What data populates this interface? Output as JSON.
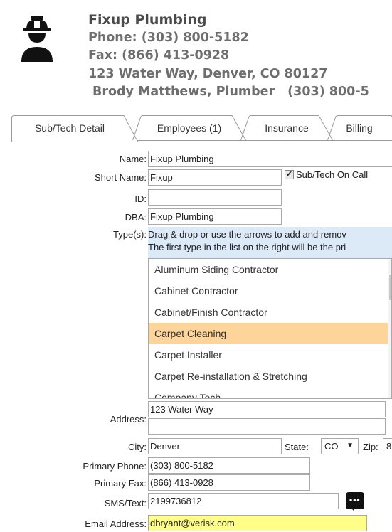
{
  "header": {
    "icon": "construction-worker-icon",
    "company_name": "Fixup Plumbing",
    "phone": "Phone: (303) 800-5182",
    "fax": "Fax: (866) 413-0928",
    "address": "123 Water Way, Denver, CO 80127",
    "contact_name": "Brody Matthews, Plumber",
    "contact_phone": "(303) 800-5"
  },
  "tabs": [
    {
      "label": "Sub/Tech Detail",
      "active": true
    },
    {
      "label": "Employees (1)",
      "active": false
    },
    {
      "label": "Insurance",
      "active": false
    },
    {
      "label": "Billing",
      "active": false
    }
  ],
  "form": {
    "name_label": "Name:",
    "name_value": "Fixup Plumbing",
    "short_name_label": "Short Name:",
    "short_name_value": "Fixup",
    "on_call_label": "Sub/Tech On Call",
    "on_call_checked": "✔",
    "id_label": "ID:",
    "id_value": "",
    "dba_label": "DBA:",
    "dba_value": "Fixup Plumbing",
    "types_label": "Type(s):",
    "types_hint_1": "Drag & drop or use the arrows to add and remov",
    "types_hint_2": "The first type in the list on the right will be the pri",
    "type_options": [
      "Aluminum Siding Contractor",
      "Cabinet Contractor",
      "Cabinet/Finish Contractor",
      "Carpet Cleaning",
      "Carpet Installer",
      "Carpet Re-installation & Stretching",
      "Company Tech"
    ],
    "selected_type": "Carpet Cleaning",
    "address_label": "Address:",
    "address_line1": "123 Water Way",
    "address_line2": "",
    "city_label": "City:",
    "city_value": "Denver",
    "state_label": "State:",
    "state_value": "CO",
    "zip_label": "Zip:",
    "zip_value": "8",
    "primary_phone_label": "Primary Phone:",
    "primary_phone_value": "(303) 800-5182",
    "primary_fax_label": "Primary Fax:",
    "primary_fax_value": "(866) 413-0928",
    "sms_label": "SMS/Text:",
    "sms_value": "2199736812",
    "sms_button_icon": "chat-bubble-icon",
    "email_label": "Email Address:",
    "email_value": "dbryant@verisk.com"
  },
  "colors": {
    "selected_row": "#fdd49a",
    "hint_background": "#dce9f7",
    "email_highlight": "#ffff88"
  }
}
